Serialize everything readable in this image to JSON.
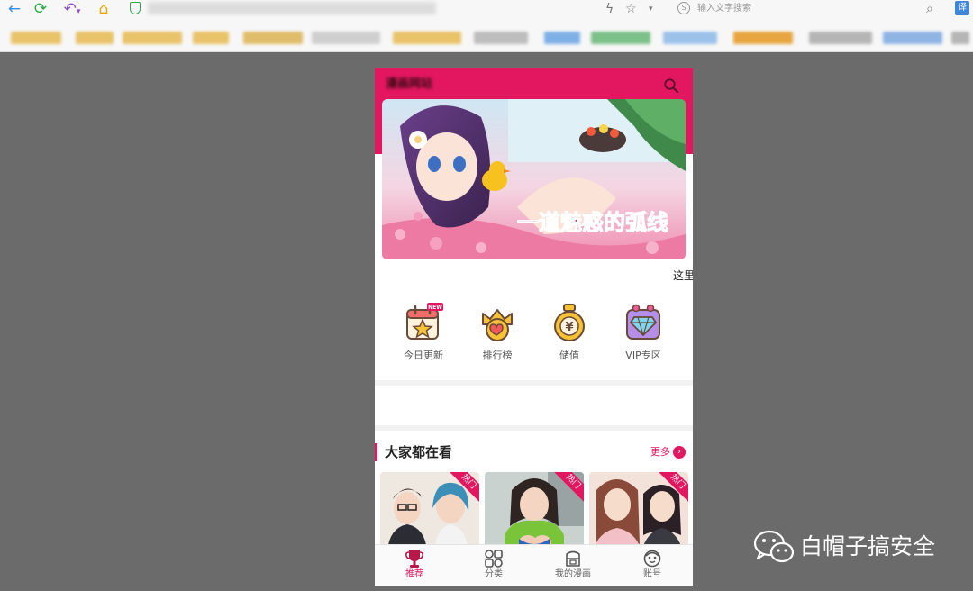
{
  "browser": {
    "search_placeholder": "输入文字搜索",
    "translate_label": "译"
  },
  "page": {
    "site_title": "漫画网站",
    "banner": {
      "slogan": "一道魅惑的弧线",
      "caption": "这里"
    },
    "features": [
      {
        "label": "今日更新",
        "icon": "calendar-star-icon",
        "badge": "NEW"
      },
      {
        "label": "排行榜",
        "icon": "crown-hearts-icon"
      },
      {
        "label": "储值",
        "icon": "coin-bag-icon",
        "symbol": "¥"
      },
      {
        "label": "VIP专区",
        "icon": "diamond-gift-icon"
      }
    ],
    "section": {
      "title": "大家都在看",
      "more_label": "更多"
    },
    "cards": [
      {
        "tag": "热门"
      },
      {
        "tag": "热门"
      },
      {
        "tag": "热门"
      }
    ],
    "bottom_nav": [
      {
        "label": "推荐",
        "icon": "trophy-icon",
        "active": true
      },
      {
        "label": "分类",
        "icon": "grid-icon",
        "active": false
      },
      {
        "label": "我的漫画",
        "icon": "book-box-icon",
        "active": false
      },
      {
        "label": "账号",
        "icon": "user-face-icon",
        "active": false
      }
    ]
  },
  "watermark": {
    "text": "白帽子搞安全"
  },
  "colors": {
    "accent": "#e3175f",
    "background": "#6b6b6b"
  }
}
